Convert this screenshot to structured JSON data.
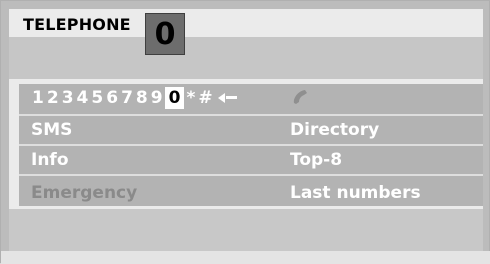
{
  "header": {
    "title": "TELEPHONE",
    "digit": "0"
  },
  "keypad": {
    "keys": [
      "1",
      "2",
      "3",
      "4",
      "5",
      "6",
      "7",
      "8",
      "9",
      "0",
      "*",
      "#"
    ],
    "selected_key": "0"
  },
  "menu": {
    "left": [
      {
        "label": "SMS",
        "enabled": true
      },
      {
        "label": "Info",
        "enabled": true
      },
      {
        "label": "Emergency",
        "enabled": false
      }
    ],
    "right": [
      {
        "label": "Directory",
        "enabled": true
      },
      {
        "label": "Top-8",
        "enabled": true
      },
      {
        "label": "Last numbers",
        "enabled": true
      }
    ]
  },
  "icons": {
    "backspace": "backspace-icon",
    "phone": "phone-handset-icon"
  },
  "colors": {
    "panel": "#b3b3b3",
    "text": "#ffffff",
    "disabled_text": "#8a8a8a",
    "badge": "#6d6d6d"
  }
}
